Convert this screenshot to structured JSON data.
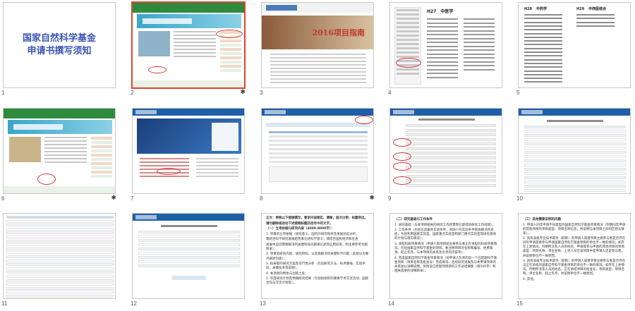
{
  "slides": [
    {
      "number": "1",
      "title_line1": "国家自然科学基金",
      "title_line2": "申请书撰写须知",
      "selected": false,
      "starred": false
    },
    {
      "number": "2",
      "selected": true,
      "starred": true
    },
    {
      "number": "3",
      "banner_text": "2016项目指南",
      "selected": false,
      "starred": false
    },
    {
      "number": "4",
      "selected": false,
      "starred": false,
      "header_code": "H27",
      "header_name": "中医学"
    },
    {
      "number": "5",
      "selected": false,
      "starred": false,
      "left_code": "H28",
      "left_name": "中药学",
      "right_code": "H29",
      "right_name": "中西医结合"
    },
    {
      "number": "6",
      "selected": false,
      "starred": true
    },
    {
      "number": "7",
      "selected": false,
      "starred": false
    },
    {
      "number": "8",
      "selected": false,
      "starred": true
    },
    {
      "number": "9",
      "selected": false,
      "starred": false
    },
    {
      "number": "10",
      "selected": false,
      "starred": false
    },
    {
      "number": "11",
      "selected": false,
      "starred": false
    },
    {
      "number": "12",
      "selected": false,
      "starred": false
    },
    {
      "number": "13",
      "selected": false,
      "starred": false,
      "text_lines": [
        "正文：参照以下提纲撰写，要求内容翔实、清晰，层次分明，标题突出。",
        "请勿删除或改动下述提纲标题及括号中的文字。",
        "（一）立项依据与研究内容（4000-8000字）：",
        "1. 项目的立项依据（研究意义、国内外研究现状及发展动态分析，",
        "需结合科学研究发展趋势来论述科学意义；或结合国民经济和社会",
        "发展中迫切需要解决的关键科技问题来论述其应用前景。附主要参考文献目录）；",
        "2. 项目的研究内容、研究目标，以及拟解决的关键科学问题（此部分为重点阐述内容）；",
        "3. 拟采取的研究方案及可行性分析（包括研究方法、技术路线、实验手段、关键技术等说明）；",
        "4. 本项目的特色与创新之处；",
        "5. 年度研究计划及预期研究结果（包括拟组织的重要学术交流活动、国际合作与交流计划等）。"
      ]
    },
    {
      "number": "14",
      "selected": false,
      "starred": false,
      "text_lines": [
        "（二）研究基础与工作条件",
        "1. 研究基础（与本项目相关的研究工作积累和已取得的研究工作成绩）；",
        "2. 工作条件（包括已具备的实验条件，尚缺少的实验条件和拟解决的途径，包括利用国家实验室、国家重点实验室和部门重点实验室等研究基地的计划与落实情况）；",
        "3. 承担科研项目情况（申请人和项目组主要参与者正在承担的科研项目情况，包括国家自然科学基金的项目，要注明项目的名称和编号、经费来源、起止年月、与本项目的关系及负责的内容等）；",
        "4. 完成国家自然科学基金项目情况（对申请人负责的前一个已结题科学基金项目（项目名称及批准号）完成情况、后续研究进展及与本申请项目的关系加以详细说明。另附该已结题项目研究工作总结摘要（限500字）和相关成果的详细目录）。"
      ]
    },
    {
      "number": "15",
      "selected": false,
      "starred": false,
      "text_lines": [
        "（三）其他需要说明的问题",
        "1. 申请人同年申请不同类型的国家自然科学基金项目情况（列明同年申请的其他项目的项目类型、项目名称信息，并说明与本项目之间的区别与联系）。",
        "2. 具有高级专业技术职务（职称）的申请人或者项目主要参与者是否存在同年申请或者参与申请国家自然科学基金项目的单位不一致的情况；如存在上述情况，列明所涉及人员的姓名，申请或参与申请的其他项目的项目类型、项目名称、单位名称、上述人员在该项目中是申请人还是参与者，并说明单位不一致原因。",
        "3. 具有高级专业技术职务（职称）的申请人或者项目主要参与者是否存在与正在承担的国家自然科学基金项目的单位不一致的情况；如存在上述情况，列明所涉及人员的姓名，正在承担项目的批准号、项目类型、项目名称、单位名称、起止年月，并说明单位不一致原因。",
        "4. 其他。"
      ]
    }
  ],
  "colors": {
    "selection": "#e0432f",
    "title_blue": "#3a56b5",
    "nsfc_green": "#2e8b3e",
    "nsfc_blue": "#1f5fa8"
  }
}
